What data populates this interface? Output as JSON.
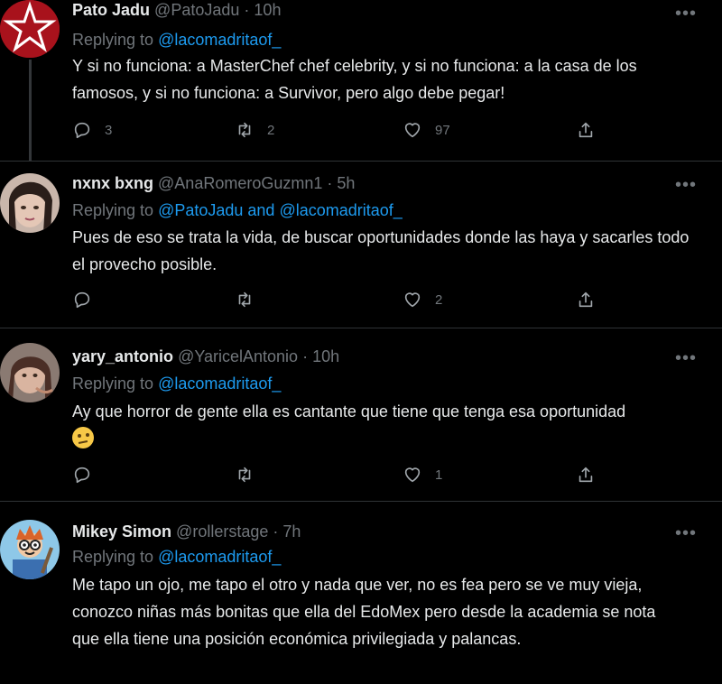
{
  "tweets": [
    {
      "name": "Pato Jadu",
      "handle": "@PatoJadu",
      "time": "10h",
      "replying_label": "Replying to",
      "replying_to": "@lacomadritaof_",
      "text": "Y si no funciona: a MasterChef chef celebrity, y si no funciona: a la casa de los famosos, y si no funciona: a Survivor, pero algo debe pegar!",
      "replies": "3",
      "retweets": "2",
      "likes": "97"
    },
    {
      "name": "nxnx bxng",
      "handle": "@AnaRomeroGuzmn1",
      "time": "5h",
      "replying_label": "Replying to",
      "replying_to": "@PatoJadu and @lacomadritaof_",
      "text": "Pues de eso se trata la vida, de buscar oportunidades donde las haya y sacarles todo el provecho posible.",
      "replies": "",
      "retweets": "",
      "likes": "2"
    },
    {
      "name": "yary_antonio",
      "handle": "@YaricelAntonio",
      "time": "10h",
      "replying_label": "Replying to",
      "replying_to": "@lacomadritaof_",
      "text": "Ay que horror de gente  ella es cantante que tiene que tenga esa oportunidad",
      "replies": "",
      "retweets": "",
      "likes": "1"
    },
    {
      "name": "Mikey Simon",
      "handle": "@rollerstage",
      "time": "7h",
      "replying_label": "Replying to",
      "replying_to": "@lacomadritaof_",
      "text": "Me tapo un ojo, me tapo el otro y nada que ver, no es fea pero se ve muy vieja, conozco niñas más bonitas que ella del EdoMex pero desde la academia se nota que ella tiene una posición económica privilegiada y palancas."
    }
  ],
  "ui": {
    "dot": "·",
    "more": "•••"
  }
}
